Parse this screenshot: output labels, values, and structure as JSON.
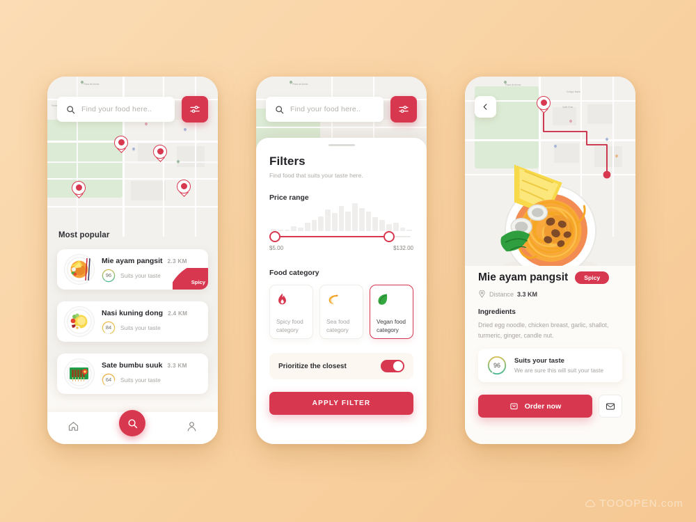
{
  "theme": {
    "accent": "#d8384f",
    "background": "#f9d3a4",
    "surface": "#ffffff",
    "muted": "#a6a3a0"
  },
  "watermark": {
    "text": "TOOOPEN.com",
    "icon": "cloud-logo-icon"
  },
  "screen_home": {
    "search": {
      "placeholder": "Find your food here..",
      "value": "",
      "icon": "search-icon"
    },
    "filter_button": {
      "icon": "sliders-icon",
      "label": "Filters"
    },
    "section_title": "Most popular",
    "map_pins": 4,
    "items": [
      {
        "title": "Mie ayam pangsit",
        "distance": "2.3 KM",
        "score": "96",
        "subtitle": "Suits your taste",
        "ribbon": "Spicy",
        "thumb": "noodle-bowl-icon"
      },
      {
        "title": "Nasi kuning dong",
        "distance": "2.4 KM",
        "score": "84",
        "subtitle": "Suits your taste",
        "ribbon": "",
        "thumb": "rice-plate-icon"
      },
      {
        "title": "Sate bumbu suuk",
        "distance": "3.3 KM",
        "score": "64",
        "subtitle": "Suits your taste",
        "ribbon": "",
        "thumb": "satay-plate-icon"
      }
    ],
    "bottom_nav": [
      {
        "name": "home",
        "icon": "home-icon"
      },
      {
        "name": "search",
        "icon": "search-icon"
      },
      {
        "name": "profile",
        "icon": "person-icon"
      }
    ]
  },
  "screen_filters": {
    "search": {
      "placeholder": "Find your food here..",
      "value": "",
      "icon": "search-icon"
    },
    "filter_button": {
      "icon": "sliders-icon"
    },
    "title": "Filters",
    "subtitle": "Find food that suits your taste here.",
    "price": {
      "label": "Price range",
      "min_label": "$5.00",
      "max_label": "$132.00",
      "histogram": [
        6,
        4,
        5,
        16,
        10,
        26,
        34,
        46,
        66,
        55,
        78,
        60,
        86,
        72,
        60,
        44,
        34,
        22,
        26,
        11,
        5
      ]
    },
    "category": {
      "label": "Food category",
      "options": [
        {
          "name": "Spicy food category",
          "icon": "flame-icon",
          "selected": false
        },
        {
          "name": "Sea food category",
          "icon": "shrimp-icon",
          "selected": false
        },
        {
          "name": "Vegan food category",
          "icon": "leaf-icon",
          "selected": true
        }
      ]
    },
    "prioritize": {
      "label": "Prioritize the closest",
      "on": true
    },
    "apply_label": "APPLY FILTER"
  },
  "screen_detail": {
    "back_icon": "chevron-left-icon",
    "hero": "noodle-bowl-illustration",
    "title": "Mie ayam pangsit",
    "chip": "Spicy",
    "distance_label": "Distance",
    "distance_value": "3.3 KM",
    "distance_icon": "location-pin-icon",
    "ingredients_label": "Ingredients",
    "ingredients_text": "Dried egg noodle, chicken breast,  garlic, shallot, turmeric, ginger, candle nut.",
    "taste": {
      "score": "96",
      "title": "Suits your taste",
      "subtitle": "We are sure this will suit your taste"
    },
    "order_label": "Order now",
    "order_icon": "bag-icon",
    "message_icon": "envelope-icon"
  }
}
